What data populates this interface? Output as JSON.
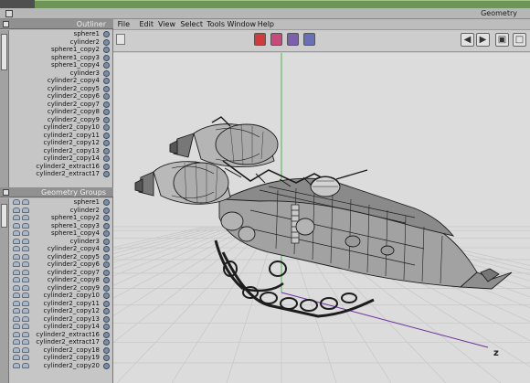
{
  "window": {
    "title": "Geometry"
  },
  "menubar": {
    "items": [
      "File",
      "Edit",
      "View",
      "Select",
      "Tools",
      "Window",
      "Help"
    ]
  },
  "toolbar": {
    "mode_colors": [
      "#d23b3b",
      "#c94a7a",
      "#7d5fb0",
      "#6a70b8"
    ]
  },
  "outliner": {
    "title": "Outliner",
    "items": [
      "sphere1",
      "cylinder2",
      "sphere1_copy2",
      "sphere1_copy3",
      "sphere1_copy4",
      "cylinder3",
      "cylinder2_copy4",
      "cylinder2_copy5",
      "cylinder2_copy6",
      "cylinder2_copy7",
      "cylinder2_copy8",
      "cylinder2_copy9",
      "cylinder2_copy10",
      "cylinder2_copy11",
      "cylinder2_copy12",
      "cylinder2_copy13",
      "cylinder2_copy14",
      "cylinder2_extract16",
      "cylinder2_extract17"
    ]
  },
  "geometry_panel": {
    "title": "Geometry Groups",
    "items": [
      "sphere1",
      "cylinder2",
      "sphere1_copy2",
      "sphere1_copy3",
      "sphere1_copy4",
      "cylinder3",
      "cylinder2_copy4",
      "cylinder2_copy5",
      "cylinder2_copy6",
      "cylinder2_copy7",
      "cylinder2_copy8",
      "cylinder2_copy9",
      "cylinder2_copy10",
      "cylinder2_copy11",
      "cylinder2_copy12",
      "cylinder2_copy13",
      "cylinder2_copy14",
      "cylinder2_extract16",
      "cylinder2_extract17",
      "cylinder2_copy18",
      "cylinder2_copy19",
      "cylinder2_copy20"
    ]
  },
  "viewport": {
    "axis_label": "z",
    "grid_color": "#c8c8c8",
    "y_axis_color": "#48b848",
    "x_axis_color": "#6d2d9a"
  }
}
